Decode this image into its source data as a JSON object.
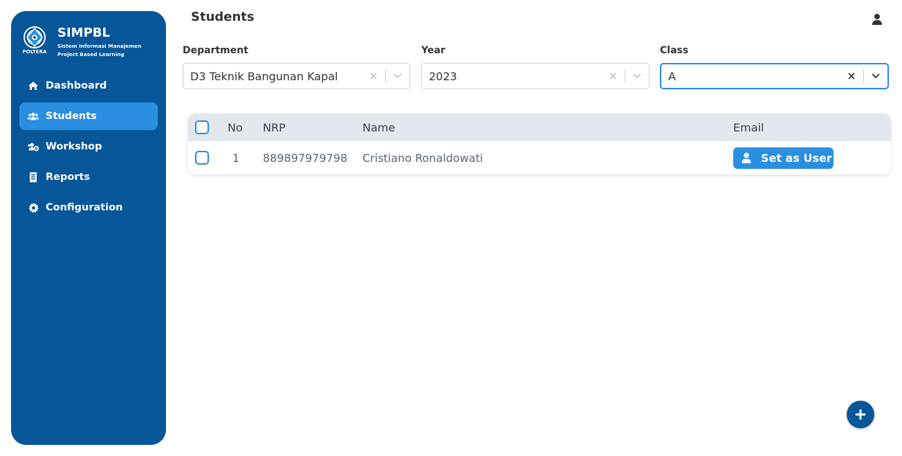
{
  "app": {
    "name": "SIMPBL",
    "subtitle_line1": "Sistem Informasi Manajemen",
    "subtitle_line2": "Project Based Learning",
    "logo_text": "POLTERA"
  },
  "sidebar": {
    "items": [
      {
        "label": "Dashboard",
        "icon": "home-icon",
        "active": false
      },
      {
        "label": "Students",
        "icon": "users-icon",
        "active": true
      },
      {
        "label": "Workshop",
        "icon": "users-cog-icon",
        "active": false
      },
      {
        "label": "Reports",
        "icon": "receipt-icon",
        "active": false
      },
      {
        "label": "Configuration",
        "icon": "gear-icon",
        "active": false
      }
    ]
  },
  "header": {
    "title": "Students",
    "user_icon": "user-icon"
  },
  "filters": {
    "department": {
      "label": "Department",
      "value": "D3 Teknik Bangunan Kapal"
    },
    "year": {
      "label": "Year",
      "value": "2023"
    },
    "class": {
      "label": "Class",
      "value": "A"
    }
  },
  "table": {
    "columns": [
      "No",
      "NRP",
      "Name",
      "Email"
    ],
    "rows": [
      {
        "no": "1",
        "nrp": "889897979798",
        "name": "Cristiano Ronaldowati",
        "action": "Set as User"
      }
    ]
  },
  "fab": {
    "icon": "plus-icon"
  },
  "colors": {
    "sidebar": "#075699",
    "accent": "#2a8fe0",
    "focus_border": "#2684ff",
    "table_header": "#e3e7ee"
  }
}
